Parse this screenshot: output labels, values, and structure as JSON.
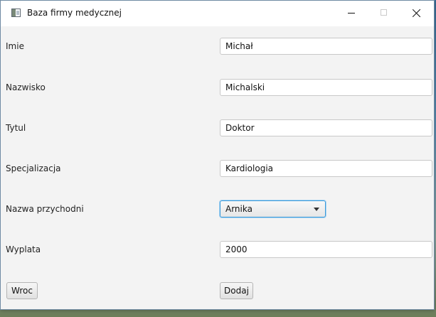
{
  "window": {
    "title": "Baza firmy medycznej"
  },
  "form": {
    "fields": [
      {
        "label": "Imie",
        "value": "Michał"
      },
      {
        "label": "Nazwisko",
        "value": "Michalski"
      },
      {
        "label": "Tytul",
        "value": "Doktor"
      },
      {
        "label": "Specjalizacja",
        "value": "Kardiologia"
      },
      {
        "label": "Nazwa przychodni",
        "value": "Arnika"
      },
      {
        "label": "Wyplata",
        "value": "2000"
      }
    ]
  },
  "buttons": {
    "back_label": "Wroc",
    "add_label": "Dodaj"
  },
  "icons": {
    "app": "window-icon",
    "minimize": "minimize-icon",
    "maximize": "maximize-icon",
    "close": "close-icon",
    "dropdown": "chevron-down-icon"
  },
  "colors": {
    "window_bg": "#f3f3f3",
    "focus_accent": "#3a9ad9"
  }
}
